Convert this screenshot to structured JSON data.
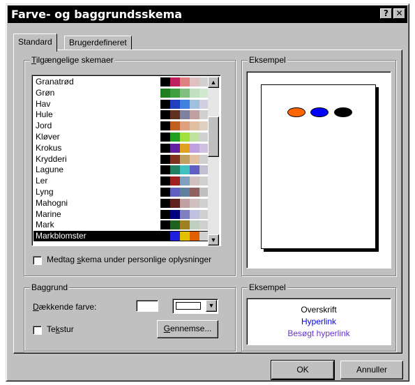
{
  "window": {
    "title": "Farve- og baggrundsskema",
    "help_glyph": "?",
    "close_glyph": "✕"
  },
  "tabs": [
    {
      "label": "Standard",
      "active": true
    },
    {
      "label": "Brugerdefineret",
      "active": false
    }
  ],
  "schemes_group": {
    "label_prefix": "",
    "label_accel": "T",
    "label_rest": "ilgængelige skemaer",
    "items": [
      {
        "name": "Granatrød",
        "colors": [
          "#000000",
          "#c02060",
          "#e08080",
          "#e0c0c0",
          "#d0d0d0"
        ]
      },
      {
        "name": "Grøn",
        "colors": [
          "#208020",
          "#40a040",
          "#80c080",
          "#c0e0c0",
          "#d0e8d0"
        ]
      },
      {
        "name": "Hav",
        "colors": [
          "#000000",
          "#2040c0",
          "#4080e0",
          "#a0c0e0",
          "#d0d0e0"
        ]
      },
      {
        "name": "Hule",
        "colors": [
          "#000000",
          "#603020",
          "#8080a0",
          "#c0a0a0",
          "#d0d0d0"
        ]
      },
      {
        "name": "Jord",
        "colors": [
          "#000000",
          "#c06020",
          "#e0a080",
          "#e0c0a0",
          "#e0d0c0"
        ]
      },
      {
        "name": "Kløver",
        "colors": [
          "#000000",
          "#20a020",
          "#a0e040",
          "#c0e0a0",
          "#d0d0d0"
        ]
      },
      {
        "name": "Krokus",
        "colors": [
          "#000000",
          "#6020a0",
          "#e0a020",
          "#c0a0e0",
          "#d0c0e0"
        ]
      },
      {
        "name": "Krydderi",
        "colors": [
          "#000000",
          "#803020",
          "#c0a060",
          "#e0c0a0",
          "#d0d0d0"
        ]
      },
      {
        "name": "Lagune",
        "colors": [
          "#000000",
          "#208060",
          "#40c0c0",
          "#6060c0",
          "#c0c0d0"
        ]
      },
      {
        "name": "Ler",
        "colors": [
          "#000000",
          "#a02020",
          "#80a0c0",
          "#d0c0c0",
          "#d0d0d0"
        ]
      },
      {
        "name": "Lyng",
        "colors": [
          "#000000",
          "#6060c0",
          "#6080a0",
          "#906060",
          "#c0c0c0"
        ]
      },
      {
        "name": "Mahogni",
        "colors": [
          "#000000",
          "#602020",
          "#c0a0a0",
          "#d0c0c0",
          "#d0d0d0"
        ]
      },
      {
        "name": "Marine",
        "colors": [
          "#000000",
          "#000080",
          "#8080c0",
          "#c0c0e0",
          "#d0d0d0"
        ]
      },
      {
        "name": "Mark",
        "colors": [
          "#000000",
          "#206020",
          "#a08020",
          "#c0d0c0",
          "#d0d0d0"
        ]
      },
      {
        "name": "Markblomster",
        "colors": [
          "#000000",
          "#2020e0",
          "#e0c000",
          "#e06000",
          "#d0d0d0"
        ],
        "selected": true
      }
    ]
  },
  "include_checkbox": {
    "label_prefix": "Medtag ",
    "label_accel": "s",
    "label_rest": "kema under personlige oplysninger",
    "checked": false
  },
  "example_top": {
    "label": "Eksempel",
    "ovals": [
      "#ff6600",
      "#0000ff",
      "#000000"
    ]
  },
  "background_group": {
    "label": "Baggrund",
    "cover_label_prefix": "",
    "cover_label_accel": "D",
    "cover_label_rest": "ækkende farve:",
    "texture_prefix": "Te",
    "texture_accel": "k",
    "texture_rest": "stur",
    "texture_checked": false,
    "browse_prefix": "",
    "browse_accel": "G",
    "browse_rest": "ennemse...",
    "dropdown_glyph": "▼"
  },
  "example_bottom": {
    "label": "Eksempel",
    "heading": "Overskrift",
    "hyperlink": "Hyperlink",
    "visited": "Besøgt hyperlink",
    "colors": {
      "heading": "#000000",
      "hyperlink": "#0000ff",
      "visited": "#6633cc"
    }
  },
  "footer": {
    "ok": "OK",
    "cancel": "Annuller"
  },
  "scrollbar": {
    "up_glyph": "▲",
    "down_glyph": "▼"
  }
}
